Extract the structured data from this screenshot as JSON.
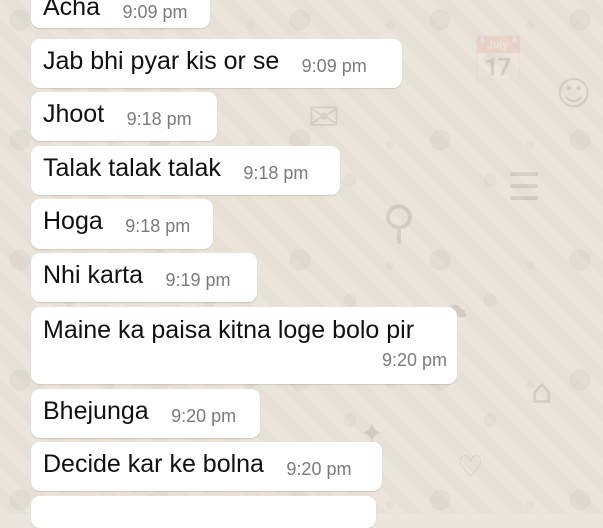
{
  "chat": {
    "messages": [
      {
        "text": "Acha",
        "time": "9:09 pm"
      },
      {
        "text": "Jab bhi pyar kis or se",
        "time": "9:09 pm"
      },
      {
        "text": "Jhoot",
        "time": "9:18 pm"
      },
      {
        "text": "Talak talak talak",
        "time": "9:18 pm"
      },
      {
        "text": "Hoga",
        "time": "9:18 pm"
      },
      {
        "text": "Nhi karta",
        "time": "9:19 pm"
      },
      {
        "text": "Maine ka paisa kitna loge bolo pir",
        "time": "9:20 pm"
      },
      {
        "text": "Bhejunga",
        "time": "9:20 pm"
      },
      {
        "text": "Decide kar ke bolna",
        "time": "9:20 pm"
      },
      {
        "text": "",
        "time": ""
      }
    ]
  },
  "theme": {
    "bubble_color": "#ffffff",
    "background": "#ebe4da",
    "time_color": "#7b7b7b",
    "text_color": "#111111"
  }
}
